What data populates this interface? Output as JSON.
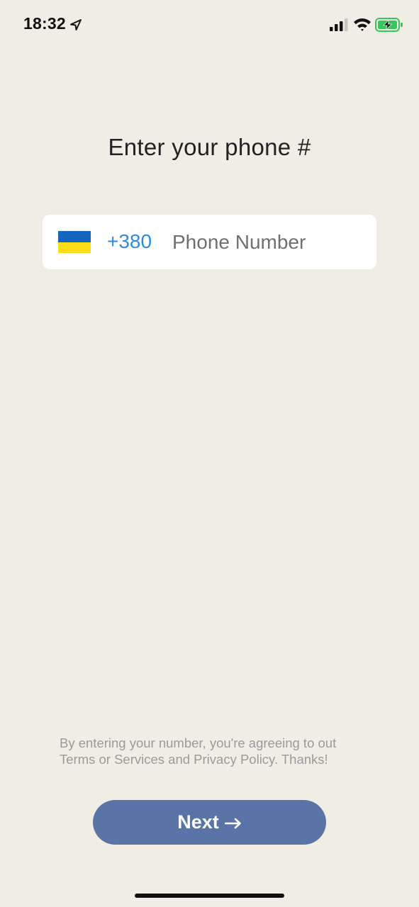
{
  "status_bar": {
    "time": "18:32",
    "icons": [
      "location-arrow-icon",
      "cellular-signal-icon",
      "wifi-icon",
      "battery-charging-icon"
    ]
  },
  "title": "Enter your phone #",
  "phone_input": {
    "country_flag": "ukraine-flag",
    "flag_colors": [
      "#1565C0",
      "#FCDC17"
    ],
    "country_code": "+380",
    "value": "",
    "placeholder": "Phone Number"
  },
  "terms": {
    "text": "By entering your number, you're agreeing to out Terms or Services and Privacy Policy. Thanks!"
  },
  "next_button": {
    "label": "Next",
    "icon": "arrow-right-icon"
  },
  "colors": {
    "background": "#F0EDE5",
    "accent": "#2F8BE0",
    "button": "#5B74A8",
    "battery": "#34C759"
  }
}
